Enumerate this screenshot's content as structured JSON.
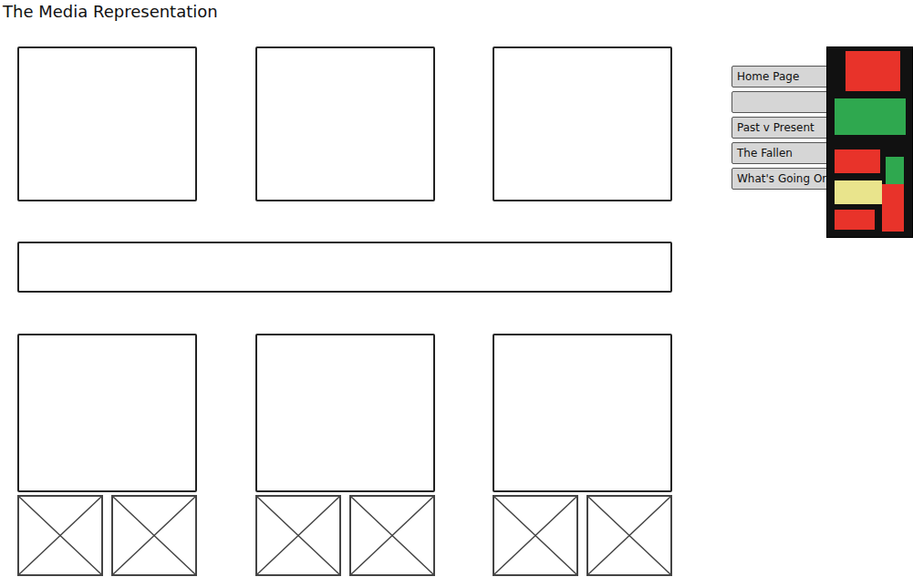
{
  "title": "The Media Representation",
  "nav": [
    {
      "label": "Home Page"
    },
    {
      "label": ""
    },
    {
      "label": "Past v Present"
    },
    {
      "label": "The Fallen"
    },
    {
      "label": "What's Going On"
    }
  ]
}
